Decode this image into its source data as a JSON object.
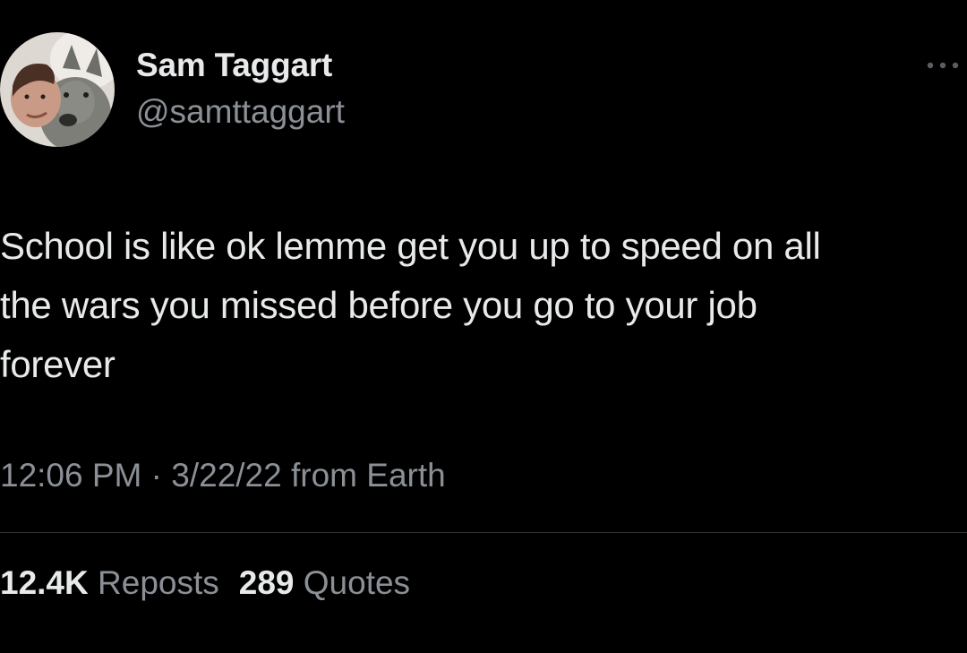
{
  "author": {
    "display_name": "Sam Taggart",
    "handle": "@samttaggart",
    "avatar_icon": "profile-photo-with-dog"
  },
  "menu": {
    "icon": "more-horizontal-icon"
  },
  "tweet": {
    "text_line_1": "School is like ok lemme get you up to speed on all",
    "text_line_2": "the wars you missed before you go to your job",
    "text_line_3": "forever"
  },
  "meta": {
    "time": "12:06 PM",
    "separator": " · ",
    "date": "3/22/22",
    "source": " from Earth"
  },
  "stats": {
    "reposts_count": "12.4K",
    "reposts_label": "Reposts",
    "quotes_count": "289",
    "quotes_label": "Quotes"
  },
  "colors": {
    "background": "#000000",
    "primary_text": "#e7e9ea",
    "secondary_text": "#8b9096",
    "divider": "#2f3336"
  }
}
